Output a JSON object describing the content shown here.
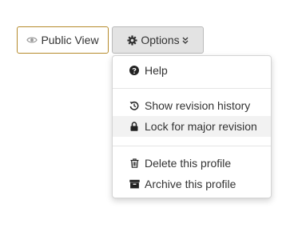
{
  "buttons": {
    "public_view": {
      "label": "Public View",
      "icon": "eye-icon"
    },
    "options": {
      "label": "Options",
      "icon": "gear-icon",
      "caret": "double-chevron-down-icon"
    }
  },
  "colors": {
    "public_border": "#b58a2a",
    "options_bg": "#e3e3e3",
    "text": "#333333",
    "highlight_bg": "#f2f2f2"
  },
  "menu": {
    "groups": [
      [
        {
          "label": "Help",
          "icon": "question-circle-icon"
        }
      ],
      [
        {
          "label": "Show revision history",
          "icon": "history-icon"
        },
        {
          "label": "Lock for major revision",
          "icon": "lock-icon",
          "highlighted": true
        }
      ],
      [
        {
          "label": "Delete this profile",
          "icon": "trash-icon"
        },
        {
          "label": "Archive this profile",
          "icon": "archive-icon"
        }
      ]
    ]
  }
}
